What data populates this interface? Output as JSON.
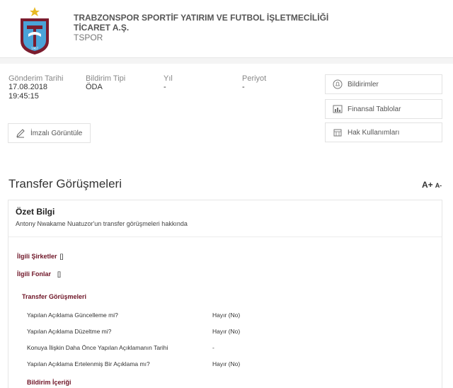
{
  "header": {
    "company_name": "TRABZONSPOR SPORTİF YATIRIM VE FUTBOL İŞLETMECİLİĞİ TİCARET A.Ş.",
    "ticker": "TSPOR",
    "logo_text": "1967"
  },
  "meta": {
    "send_date_label": "Gönderim Tarihi",
    "send_date": "17.08.2018",
    "send_time": "19:45:15",
    "type_label": "Bildirim Tipi",
    "type_value": "ÖDA",
    "year_label": "Yıl",
    "year_value": "-",
    "period_label": "Periyot",
    "period_value": "-"
  },
  "side_buttons": {
    "notifications": "Bildirimler",
    "financials": "Finansal Tablolar",
    "rights": "Hak Kullanımları"
  },
  "sign_button": "İmzalı Görüntüle",
  "page_title": "Transfer Görüşmeleri",
  "font_controls": {
    "increase": "A+",
    "decrease": "A-"
  },
  "summary": {
    "title": "Özet Bilgi",
    "text": "Antony Nwakame Nuatuzor'un transfer görüşmeleri hakkında"
  },
  "related": {
    "companies_label": "İlgili Şirketler",
    "companies_value": "[]",
    "funds_label": "İlgili Fonlar",
    "funds_value": "[]"
  },
  "section_title": "Transfer Görüşmeleri",
  "rows": [
    {
      "label": "Yapılan Açıklama Güncelleme mi?",
      "value": "Hayır (No)"
    },
    {
      "label": "Yapılan Açıklama Düzeltme mi?",
      "value": "Hayır (No)"
    },
    {
      "label": "Konuya İlişkin Daha Önce Yapılan Açıklamanın Tarihi",
      "value": "-"
    },
    {
      "label": "Yapılan Açıklama Ertelenmiş Bir Açıklama mı?",
      "value": "Hayır (No)"
    }
  ],
  "content_title": "Bildirim İçeriği",
  "colors": {
    "accent": "#6e1426",
    "brand_blue": "#4aa3d8",
    "brand_maroon": "#7b1c2e"
  }
}
